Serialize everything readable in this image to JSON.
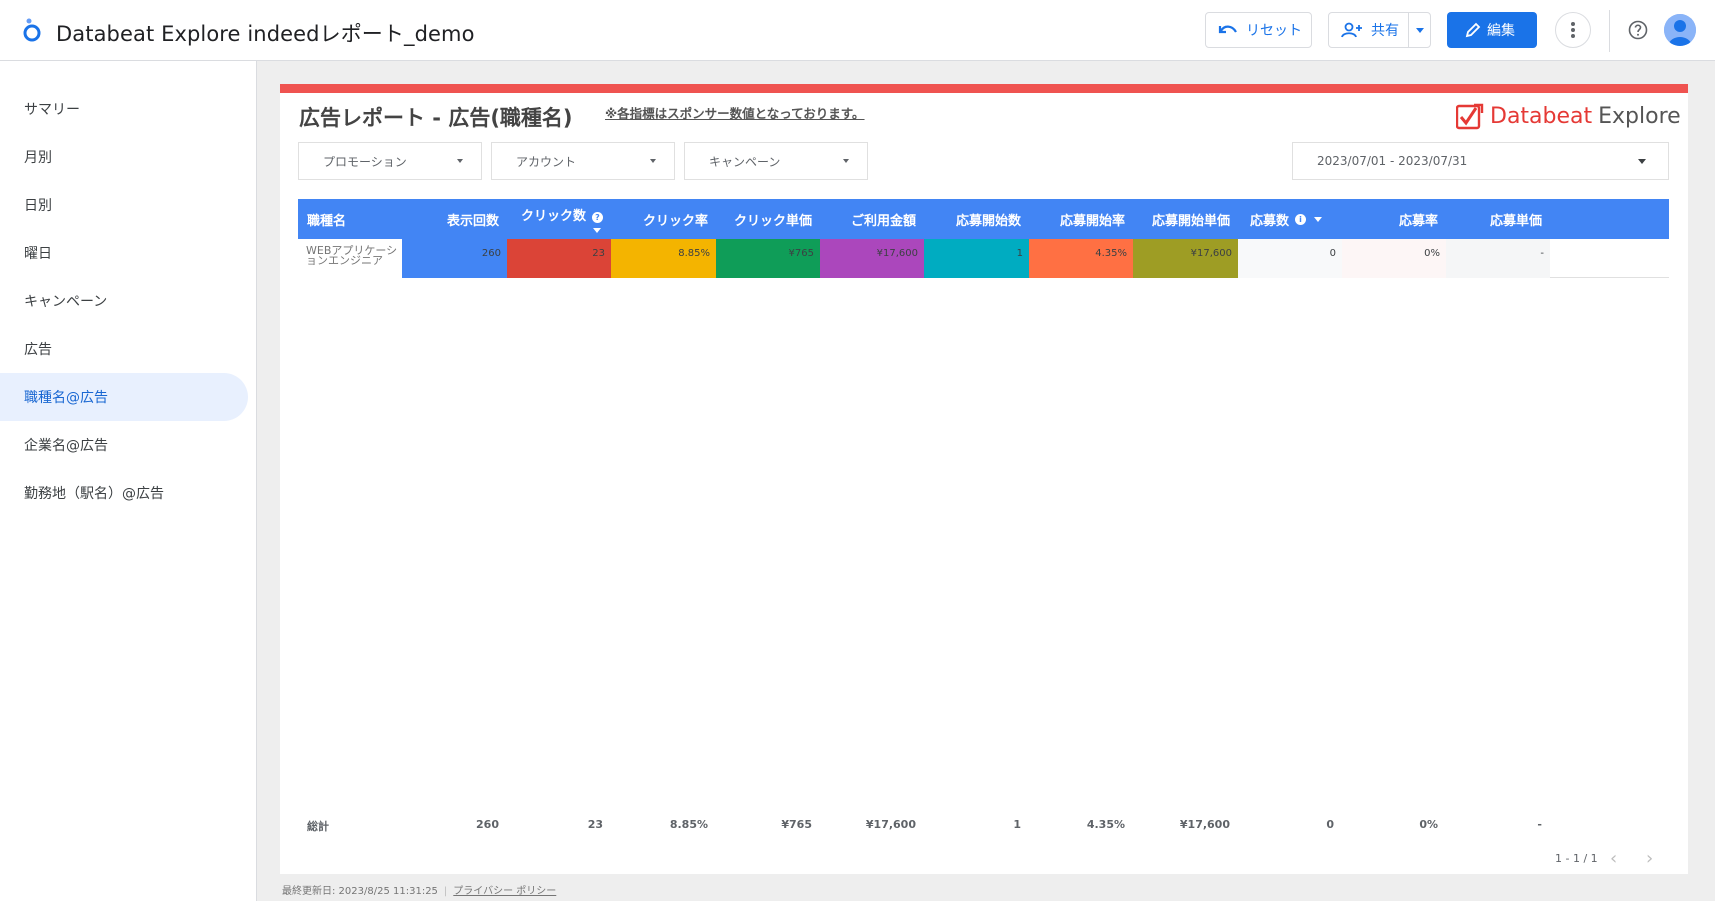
{
  "app": {
    "title": "Databeat Explore indeedレポート_demo",
    "reset_label": "リセット",
    "share_label": "共有",
    "edit_label": "編集"
  },
  "sidebar": {
    "items": [
      {
        "label": "サマリー"
      },
      {
        "label": "月別"
      },
      {
        "label": "日別"
      },
      {
        "label": "曜日"
      },
      {
        "label": "キャンペーン"
      },
      {
        "label": "広告"
      },
      {
        "label": "職種名@広告"
      },
      {
        "label": "企業名@広告"
      },
      {
        "label": "勤務地（駅名）@広告"
      }
    ],
    "active_index": 6
  },
  "report": {
    "title": "広告レポート - 広告(職種名)",
    "note": "※各指標はスポンサー数値となっております。",
    "brand_name": "Databeat",
    "brand_suffix": "Explore",
    "filters": {
      "promotion": "プロモーション",
      "account": "アカウント",
      "campaign": "キャンペーン",
      "date_range": "2023/07/01 - 2023/07/31"
    },
    "table": {
      "headers": [
        "職種名",
        "表示回数",
        "クリック数",
        "クリック率",
        "クリック単価",
        "ご利用金額",
        "応募開始数",
        "応募開始率",
        "応募開始単価",
        "応募数",
        "応募率",
        "応募単価"
      ],
      "rows": [
        [
          "WEBアプリケーションエンジニア",
          "260",
          "23",
          "8.85%",
          "¥765",
          "¥17,600",
          "1",
          "4.35%",
          "¥17,600",
          "0",
          "0%",
          "-"
        ]
      ],
      "cell_colors": [
        "#ffffff",
        "#4285f4",
        "#db4437",
        "#f4b400",
        "#0f9d58",
        "#ab47bc",
        "#00acc1",
        "#ff7043",
        "#9e9d24",
        "#f8f9fa",
        "#fdf6f6",
        "#f5f6f7"
      ],
      "header_color": "#4285f4",
      "totals_label": "総計",
      "totals": [
        "260",
        "23",
        "8.85%",
        "¥765",
        "¥17,600",
        "1",
        "4.35%",
        "¥17,600",
        "0",
        "0%",
        "-"
      ],
      "pagination": "1 - 1 / 1"
    }
  },
  "footer": {
    "last_updated": "最終更新日: 2023/8/25 11:31:25",
    "privacy_link": "プライバシー ポリシー"
  },
  "colors": {
    "accent": "#1a73e8",
    "report_bar": "#ef5350",
    "brand_red": "#e53935"
  }
}
